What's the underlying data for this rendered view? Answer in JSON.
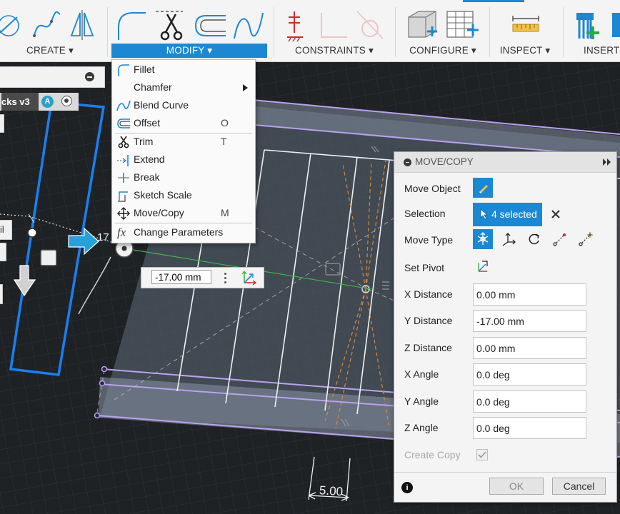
{
  "toolbar": {
    "groups": [
      {
        "label": "CREATE ▾"
      },
      {
        "label": "MODIFY ▾"
      },
      {
        "label": "CONSTRAINTS ▾"
      },
      {
        "label": "CONFIGURE ▾"
      },
      {
        "label": "INSPECT ▾"
      },
      {
        "label": "INSERT"
      }
    ]
  },
  "browser": {
    "component_name": "cks v3",
    "badge": "A",
    "sliver_text": "il"
  },
  "modify_menu": {
    "items": [
      {
        "label": "Fillet",
        "shortcut": "",
        "icon": "fillet-icon"
      },
      {
        "label": "Chamfer",
        "shortcut": "",
        "icon": "chamfer-icon",
        "submenu": true
      },
      {
        "label": "Blend Curve",
        "shortcut": "",
        "icon": "blend-curve-icon"
      },
      {
        "label": "Offset",
        "shortcut": "O",
        "icon": "offset-icon"
      },
      {
        "label": "Trim",
        "shortcut": "T",
        "icon": "trim-icon"
      },
      {
        "label": "Extend",
        "shortcut": "",
        "icon": "extend-icon"
      },
      {
        "label": "Break",
        "shortcut": "",
        "icon": "break-icon"
      },
      {
        "label": "Sketch Scale",
        "shortcut": "",
        "icon": "sketch-scale-icon"
      },
      {
        "label": "Move/Copy",
        "shortcut": "M",
        "icon": "move-copy-icon"
      },
      {
        "label": "Change Parameters",
        "shortcut": "",
        "icon": "fx-icon"
      }
    ]
  },
  "distance_input": {
    "value": "-17.00 mm"
  },
  "viewport": {
    "dimension_label": "5.00",
    "arrow_label": "17"
  },
  "move_copy": {
    "title": "MOVE/COPY",
    "move_object_label": "Move Object",
    "selection_label": "Selection",
    "selection_value": "4 selected",
    "move_type_label": "Move Type",
    "set_pivot_label": "Set Pivot",
    "x_distance_label": "X Distance",
    "x_distance": "0.00 mm",
    "y_distance_label": "Y Distance",
    "y_distance": "-17.00 mm",
    "z_distance_label": "Z Distance",
    "z_distance": "0.00 mm",
    "x_angle_label": "X Angle",
    "x_angle": "0.0 deg",
    "y_angle_label": "Y Angle",
    "y_angle": "0.0 deg",
    "z_angle_label": "Z Angle",
    "z_angle": "0.0 deg",
    "create_copy_label": "Create Copy",
    "create_copy_checked": true,
    "ok_label": "OK",
    "cancel_label": "Cancel"
  },
  "colors": {
    "accent": "#1b88d4",
    "viewport_bg": "#1f2225",
    "sketch_blue": "#1a7ff0",
    "profile_purple": "#b39be8"
  }
}
